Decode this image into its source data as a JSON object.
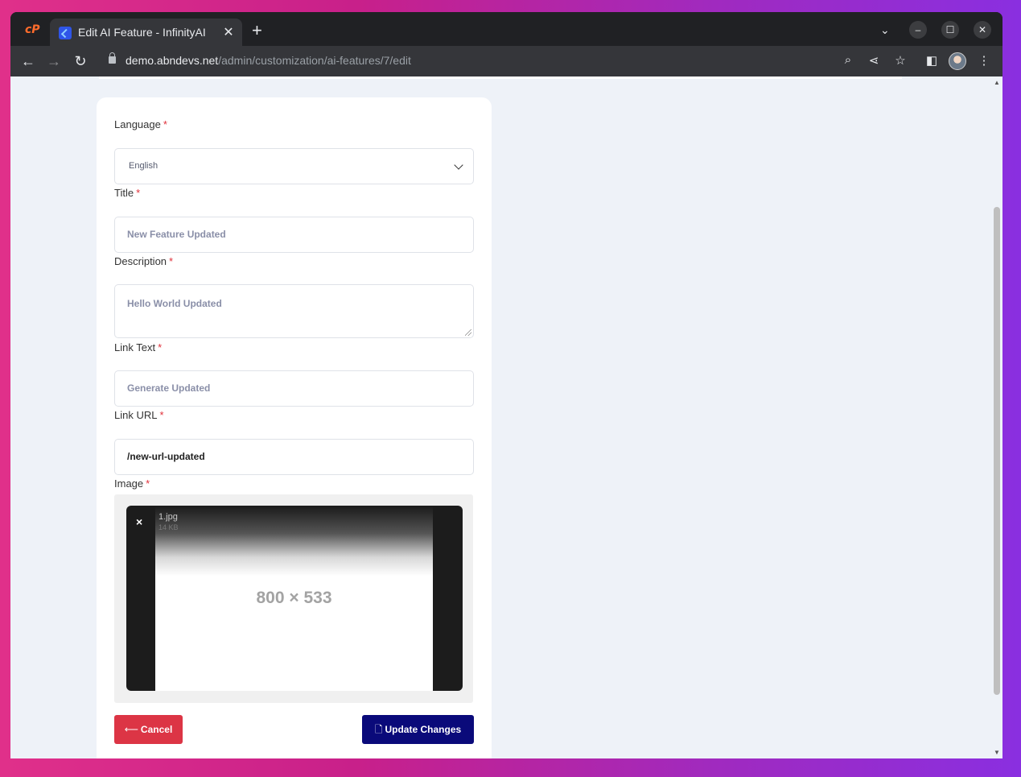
{
  "browser": {
    "tab_title": "Edit AI Feature - InfinityAI",
    "tab_close": "✕",
    "new_tab": "+",
    "url_host": "demo.abndevs.net",
    "url_path": "/admin/customization/ai-features/7/edit",
    "cp_logo": "cP"
  },
  "form": {
    "language": {
      "label": "Language",
      "required": "*",
      "value": "English"
    },
    "title": {
      "label": "Title",
      "required": "*",
      "placeholder": "New Feature Updated"
    },
    "description": {
      "label": "Description",
      "required": "*",
      "placeholder": "Hello World Updated"
    },
    "link_text": {
      "label": "Link Text",
      "required": "*",
      "placeholder": "Generate Updated"
    },
    "link_url": {
      "label": "Link URL",
      "required": "*",
      "value": "/new-url-updated"
    },
    "image": {
      "label": "Image",
      "required": "*",
      "file_name": "1.jpg",
      "file_size": "14 KB",
      "placeholder_text": "800 × 533",
      "remove": "×"
    }
  },
  "buttons": {
    "cancel": "Cancel",
    "cancel_icon": "⟵",
    "update": "Update Changes",
    "update_icon": "🗋"
  },
  "colors": {
    "cancel_bg": "#dc3545",
    "update_bg": "#0a0a7a",
    "required": "#e0303a",
    "page_bg": "#eef2f8"
  }
}
